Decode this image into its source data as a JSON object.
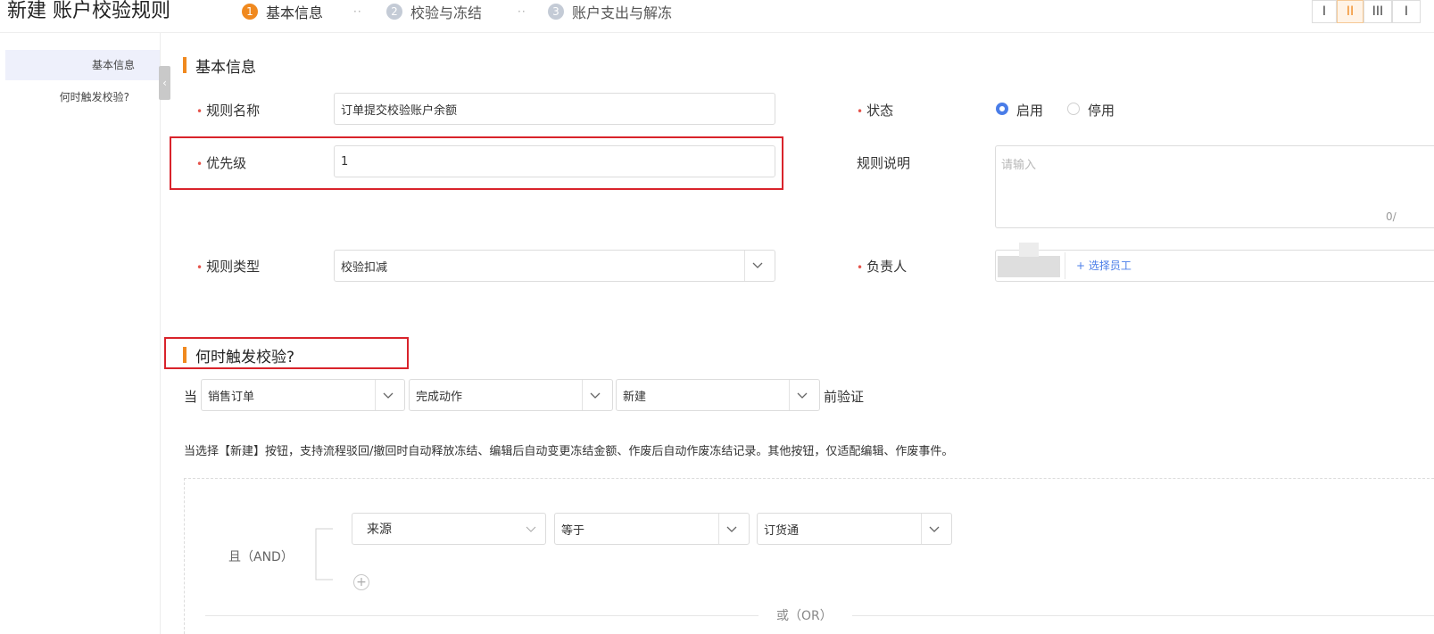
{
  "header": {
    "title": "新建 账户校验规则",
    "steps": [
      {
        "num": "1",
        "label": "基本信息"
      },
      {
        "num": "2",
        "label": "校验与冻结"
      },
      {
        "num": "3",
        "label": "账户支出与解冻"
      }
    ],
    "separator": "··",
    "layout_buttons": [
      "I",
      "II",
      "III",
      "I"
    ]
  },
  "sidebar": {
    "items": [
      {
        "label": "基本信息"
      },
      {
        "label": "何时触发校验?"
      }
    ],
    "collapse_icon": "‹"
  },
  "basic": {
    "section_title": "基本信息",
    "required_mark": "•",
    "rule_name": {
      "label": "规则名称",
      "value": "订单提交校验账户余额"
    },
    "priority": {
      "label": "优先级",
      "value": "1"
    },
    "rule_type": {
      "label": "规则类型",
      "value": "校验扣减"
    },
    "status": {
      "label": "状态",
      "options": [
        "启用",
        "停用"
      ],
      "selected": "启用"
    },
    "description": {
      "label": "规则说明",
      "placeholder": "请输入",
      "counter": "0/"
    },
    "owner": {
      "label": "负责人",
      "add_label": "+ 选择员工"
    }
  },
  "trigger": {
    "section_title": "何时触发校验?",
    "prefix": "当",
    "selects": [
      "销售订单",
      "完成动作",
      "新建"
    ],
    "suffix": "前验证",
    "note": "当选择【新建】按钮，支持流程驳回/撤回时自动释放冻结、编辑后自动变更冻结金额、作废后自动作废冻结记录。其他按钮，仅适配编辑、作废事件。",
    "logic_and": "且（AND）",
    "logic_or": "或（OR）",
    "condition": {
      "field": "来源",
      "operator": "等于",
      "value": "订货通"
    },
    "add_icon": "+"
  },
  "colors": {
    "accent": "#f0891f",
    "primary": "#4a7de8",
    "highlight": "#d9232b"
  }
}
